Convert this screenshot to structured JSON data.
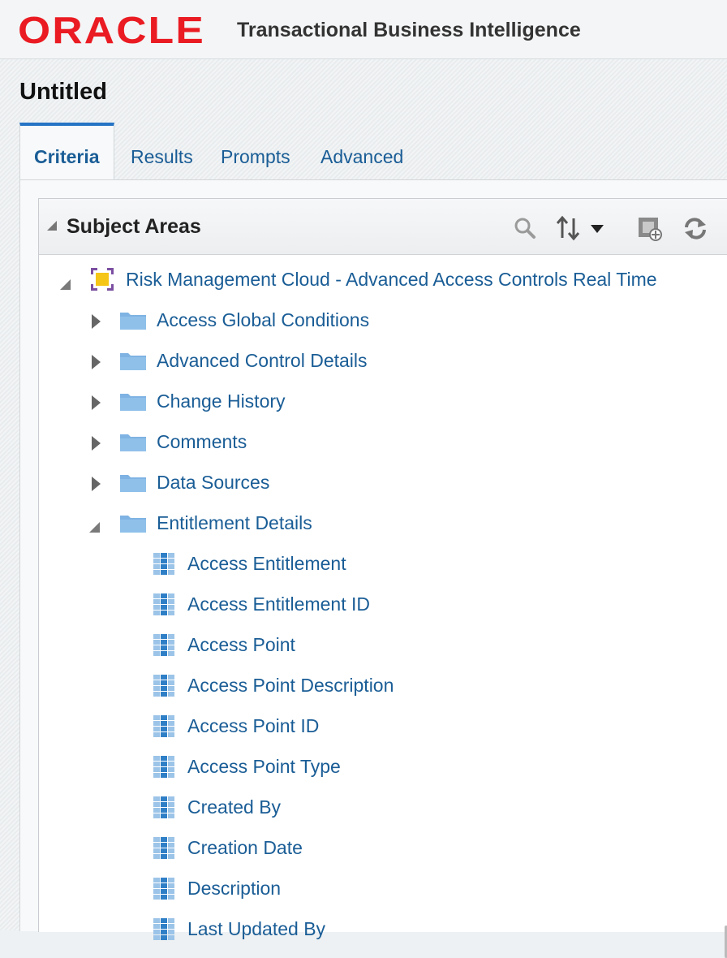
{
  "header": {
    "logo": "ORACLE",
    "app_title": "Transactional Business Intelligence"
  },
  "page": {
    "title": "Untitled"
  },
  "tabs": [
    {
      "label": "Criteria",
      "active": true
    },
    {
      "label": "Results",
      "active": false
    },
    {
      "label": "Prompts",
      "active": false
    },
    {
      "label": "Advanced",
      "active": false
    }
  ],
  "panel": {
    "title": "Subject Areas",
    "toolbar": [
      "search-icon",
      "sort-icon",
      "dropdown-icon",
      "add-subject-area-icon",
      "refresh-icon"
    ]
  },
  "tree": {
    "subject_area": "Risk Management Cloud - Advanced Access Controls Real Time",
    "folders": [
      {
        "label": "Access Global Conditions",
        "expanded": false
      },
      {
        "label": "Advanced Control Details",
        "expanded": false
      },
      {
        "label": "Change History",
        "expanded": false
      },
      {
        "label": "Comments",
        "expanded": false
      },
      {
        "label": "Data Sources",
        "expanded": false
      },
      {
        "label": "Entitlement Details",
        "expanded": true
      }
    ],
    "columns": [
      "Access Entitlement",
      "Access Entitlement ID",
      "Access Point",
      "Access Point Description",
      "Access Point ID",
      "Access Point Type",
      "Created By",
      "Creation Date",
      "Description",
      "Last Updated By"
    ]
  },
  "colors": {
    "oracle_red": "#ea1b22",
    "link_blue": "#1a5d96",
    "tab_accent": "#2674c5",
    "folder_blue": "#7fb3e3"
  }
}
